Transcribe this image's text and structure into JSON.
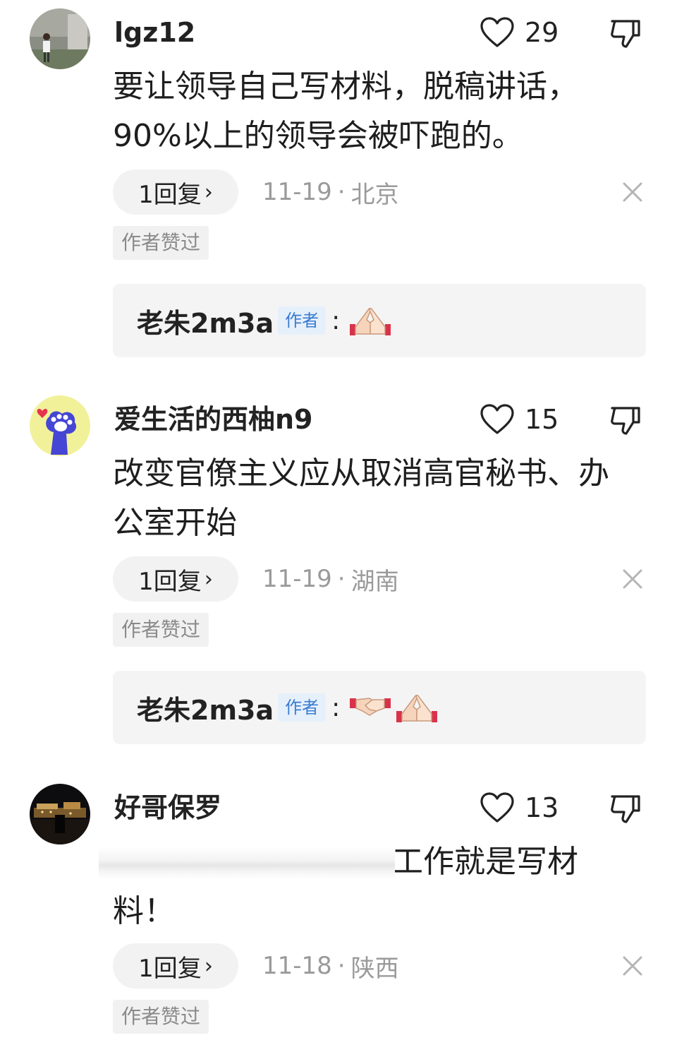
{
  "comments": [
    {
      "username": "lgz12",
      "likes": "29",
      "text": "要让领导自己写材料，脱稿讲话，90%以上的领导会被吓跑的。",
      "reply_label": "1回复",
      "date": "11-19",
      "location": "北京",
      "badge": "作者赞过",
      "author_reply": {
        "name": "老朱2m3a",
        "tag": "作者",
        "colon": ":"
      }
    },
    {
      "username": "爱生活的西柚n9",
      "likes": "15",
      "text": "改变官僚主义应从取消高官秘书、办公室开始",
      "reply_label": "1回复",
      "date": "11-19",
      "location": "湖南",
      "badge": "作者赞过",
      "author_reply": {
        "name": "老朱2m3a",
        "tag": "作者",
        "colon": ":"
      }
    },
    {
      "username": "好哥保罗",
      "likes": "13",
      "text": "工作就是写材",
      "text_line2": "料！",
      "reply_label": "1回复",
      "date": "11-18",
      "location": "陕西",
      "badge": "作者赞过"
    }
  ],
  "icons": {
    "like": "heart-outline-icon",
    "dislike": "thumbs-down-icon",
    "close": "close-icon",
    "chevron": "chevron-right-icon"
  },
  "colors": {
    "author_tag_bg": "#e6f0fb",
    "author_tag_text": "#3b7bd1",
    "meta_text": "#9a9a9a"
  }
}
